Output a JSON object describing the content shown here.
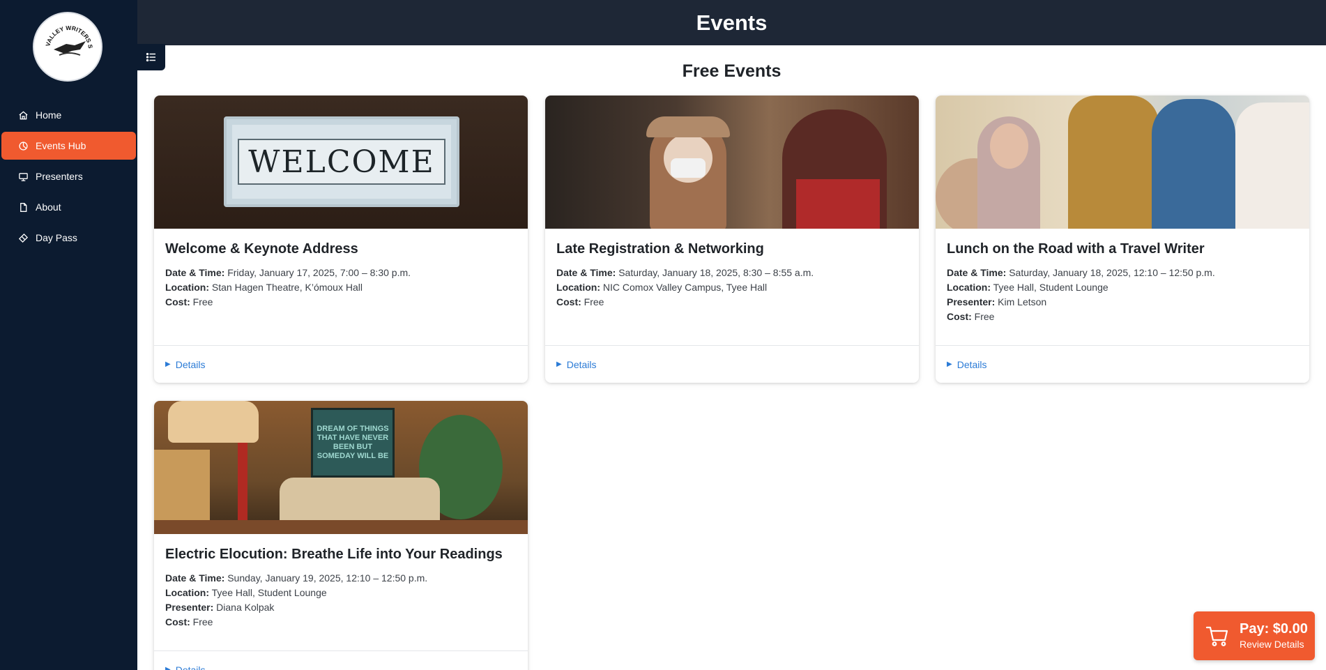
{
  "sidebar": {
    "logo": {
      "icon": "comox-valley-writers-society-logo",
      "text": "COMOX VALLEY WRITERS SOCIETY"
    },
    "items": [
      {
        "label": "Home",
        "icon": "home-icon",
        "active": false
      },
      {
        "label": "Events Hub",
        "icon": "events-hub-icon",
        "active": true
      },
      {
        "label": "Presenters",
        "icon": "presenter-screen-icon",
        "active": false
      },
      {
        "label": "About",
        "icon": "document-icon",
        "active": false
      },
      {
        "label": "Day Pass",
        "icon": "ticket-icon",
        "active": false
      }
    ]
  },
  "header": {
    "title": "Events"
  },
  "main": {
    "section_title": "Free Events",
    "labels": {
      "datetime": "Date & Time:",
      "location": "Location:",
      "presenter": "Presenter:",
      "cost": "Cost:"
    },
    "details_label": "Details",
    "events": [
      {
        "title": "Welcome & Keynote Address",
        "datetime": "Friday, January 17, 2025, 7:00 – 8:30 p.m.",
        "location": "Stan Hagen Theatre, K’ómoux Hall",
        "cost": "Free",
        "image_text": "WELCOME"
      },
      {
        "title": "Late Registration & Networking",
        "datetime": "Saturday, January 18, 2025, 8:30 – 8:55 a.m.",
        "location": "NIC Comox Valley Campus, Tyee Hall",
        "cost": "Free"
      },
      {
        "title": "Lunch on the Road with a Travel Writer",
        "datetime": "Saturday, January 18, 2025, 12:10 – 12:50 p.m.",
        "location": "Tyee Hall, Student Lounge",
        "presenter": "Kim Letson",
        "cost": "Free"
      },
      {
        "title": "Electric Elocution: Breathe Life into Your Readings",
        "datetime": "Sunday, January 19, 2025, 12:10 – 12:50 p.m.",
        "location": "Tyee Hall, Student Lounge",
        "presenter": "Diana Kolpak",
        "cost": "Free",
        "image_text": "DREAM OF THINGS THAT HAVE NEVER BEEN BUT SOMEDAY WILL BE"
      }
    ]
  },
  "pay": {
    "amount": "Pay: $0.00",
    "review": "Review Details",
    "icon": "cart-icon"
  },
  "colors": {
    "sidebar_bg": "#0c1b30",
    "header_bg": "#1e2736",
    "accent": "#f05a2f",
    "link": "#2b7bd6"
  }
}
